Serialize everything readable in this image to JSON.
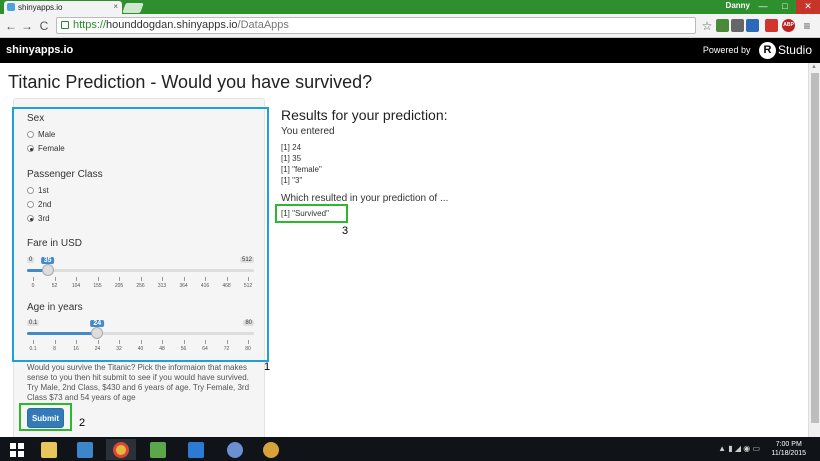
{
  "browser": {
    "tab_title": "shinyapps.io",
    "tab_close": "×",
    "user": "Danny",
    "url_scheme": "https://",
    "url_host": "hounddogdan.shinyapps.io",
    "url_path": "/DataApps",
    "back": "←",
    "forward": "→",
    "reload": "C",
    "star": "☆",
    "menu": "≡",
    "ext_abp": "ABP",
    "window_min": "—",
    "window_max": "□",
    "window_close": "✕"
  },
  "header": {
    "brand": "shinyapps.io",
    "powered_by": "Powered by",
    "r_logo": "R",
    "studio": "Studio"
  },
  "app": {
    "title": "Titanic Prediction - Would you have survived?",
    "sex": {
      "label": "Sex",
      "options": [
        "Male",
        "Female"
      ],
      "selected": 1
    },
    "pclass": {
      "label": "Passenger Class",
      "options": [
        "1st",
        "2nd",
        "3rd"
      ],
      "selected": 2
    },
    "fare": {
      "label": "Fare in USD",
      "min": 0,
      "max": 512,
      "value": 35,
      "min_label": "0",
      "max_label": "512",
      "value_label": "35",
      "ticks": [
        "0",
        "52",
        "104",
        "155",
        "205",
        "256",
        "313",
        "364",
        "416",
        "468",
        "512"
      ]
    },
    "age": {
      "label": "Age in years",
      "min": 0.1,
      "max": 80,
      "value": 24,
      "min_label": "0.1",
      "max_label": "80",
      "value_label": "24",
      "ticks": [
        "0.1",
        "8",
        "16",
        "24",
        "32",
        "40",
        "48",
        "56",
        "64",
        "72",
        "80"
      ]
    },
    "help_text": "Would you survive the Titanic? Pick the informaion that makes sense to you then hit submit to see if you would have survived. Try Male, 2nd Class, $430 and 6 years of age. Try Female, 3rd Class $73 and 54 years of age",
    "submit_label": "Submit",
    "results": {
      "title": "Results for your prediction:",
      "you_entered": "You entered",
      "lines": [
        "[1] 24",
        "[1] 35",
        "[1] \"female\"",
        "[1] \"3\""
      ],
      "which_resulted": "Which resulted in your prediction of ...",
      "prediction": "[1] \"Survived\""
    }
  },
  "annotations": {
    "one": "1",
    "two": "2",
    "three": "3"
  },
  "taskbar": {
    "time": "7:00 PM",
    "date": "11/18/2015"
  }
}
